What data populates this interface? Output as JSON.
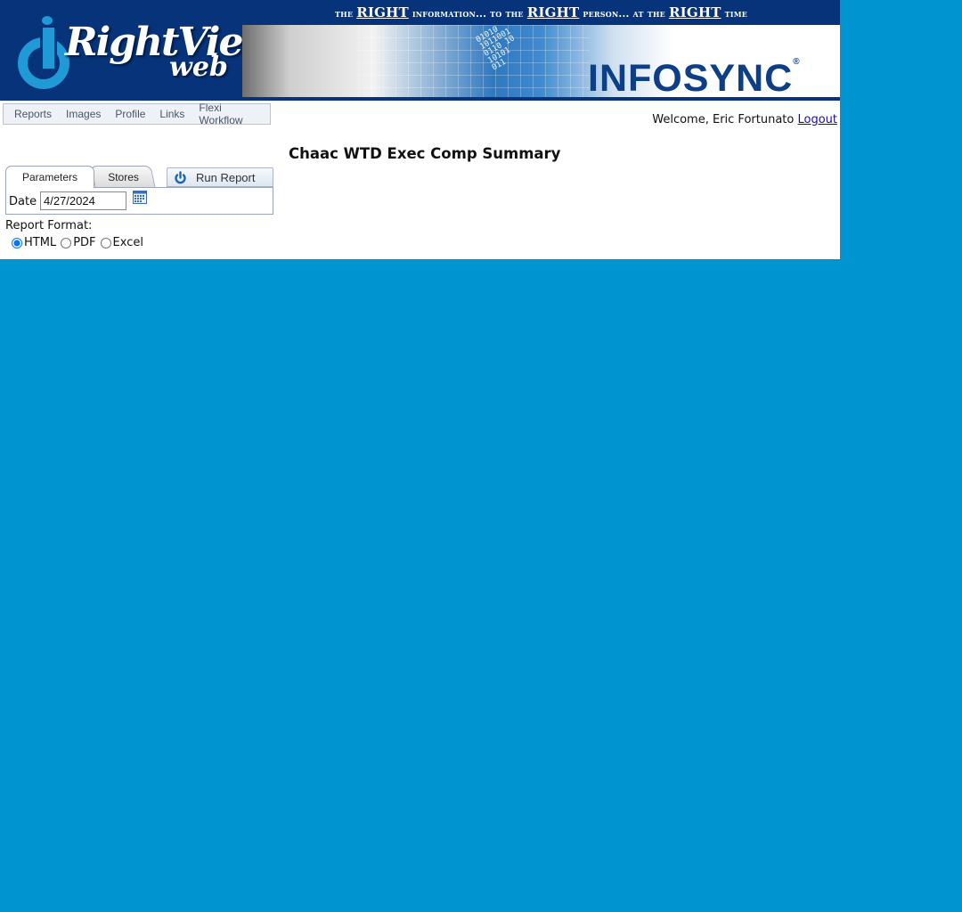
{
  "header": {
    "logo_main": "RightView",
    "logo_sub": "web",
    "tagline": {
      "parts": [
        "the ",
        "RIGHT",
        " information... to the ",
        "RIGHT",
        " person... at the ",
        "RIGHT",
        " time"
      ]
    },
    "banner_brand": "INFOSYNC",
    "banner_digits": "01010\n1011001\n0110 10\n10101\n011"
  },
  "menu": {
    "items": [
      "Reports",
      "Images",
      "Profile",
      "Links",
      "Flexi Workflow"
    ]
  },
  "user": {
    "welcome": "Welcome, Eric Fortunato",
    "logout": "Logout"
  },
  "report": {
    "title": "Chaac WTD Exec Comp Summary"
  },
  "tabs": {
    "parameters": "Parameters",
    "stores": "Stores",
    "run_report": "Run Report"
  },
  "params": {
    "date_label": "Date",
    "date_value": "4/27/2024"
  },
  "format": {
    "label": "Report Format:",
    "options": [
      "HTML",
      "PDF",
      "Excel"
    ],
    "selected": "HTML"
  },
  "colors": {
    "background": "#0094d0",
    "header": "#06337a",
    "logo_blue": "#1f9ad6",
    "brand_blue": "#0d3f86"
  }
}
